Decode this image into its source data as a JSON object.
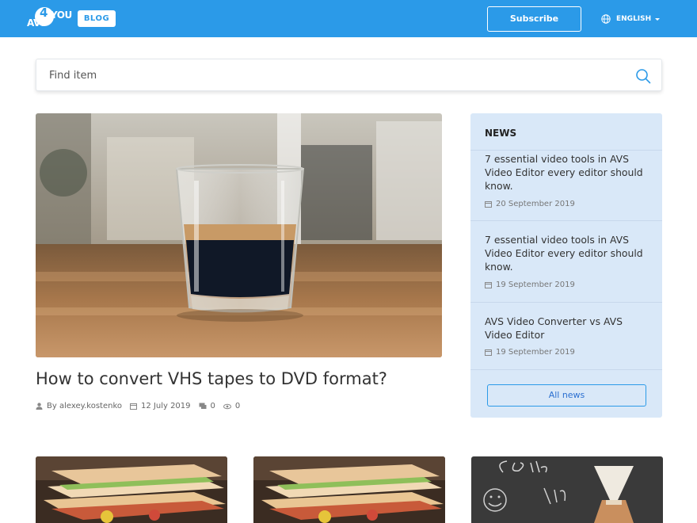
{
  "header": {
    "logo_top": "4",
    "logo_avs": "AVS",
    "logo_you": "YOU",
    "blog_label": "BLOG",
    "subscribe_label": "Subscribe",
    "language_label": "ENGLISH",
    "brand_color": "#2b9ae8"
  },
  "search": {
    "placeholder": "Find item",
    "icon": "search-icon"
  },
  "featured": {
    "title": "How to convert VHS tapes to DVD format?",
    "author": "By alexey.kostenko",
    "date": "12 July 2019",
    "comments": "0",
    "views": "0"
  },
  "news": {
    "heading": "NEWS",
    "items": [
      {
        "title": "7 essential video tools in AVS Video Editor every editor should know.",
        "date": "20 September 2019"
      },
      {
        "title": "7 essential video tools in AVS Video Editor every editor should know.",
        "date": "19 September 2019"
      },
      {
        "title": "AVS Video Converter vs AVS Video Editor",
        "date": "19 September 2019"
      }
    ],
    "all_news_label": "All news",
    "panel_color": "#d9e8f8"
  },
  "cards": [
    {
      "image": "sandwich-photo"
    },
    {
      "image": "sandwich-photo"
    },
    {
      "image": "coffee-time-chalkboard-photo"
    }
  ]
}
